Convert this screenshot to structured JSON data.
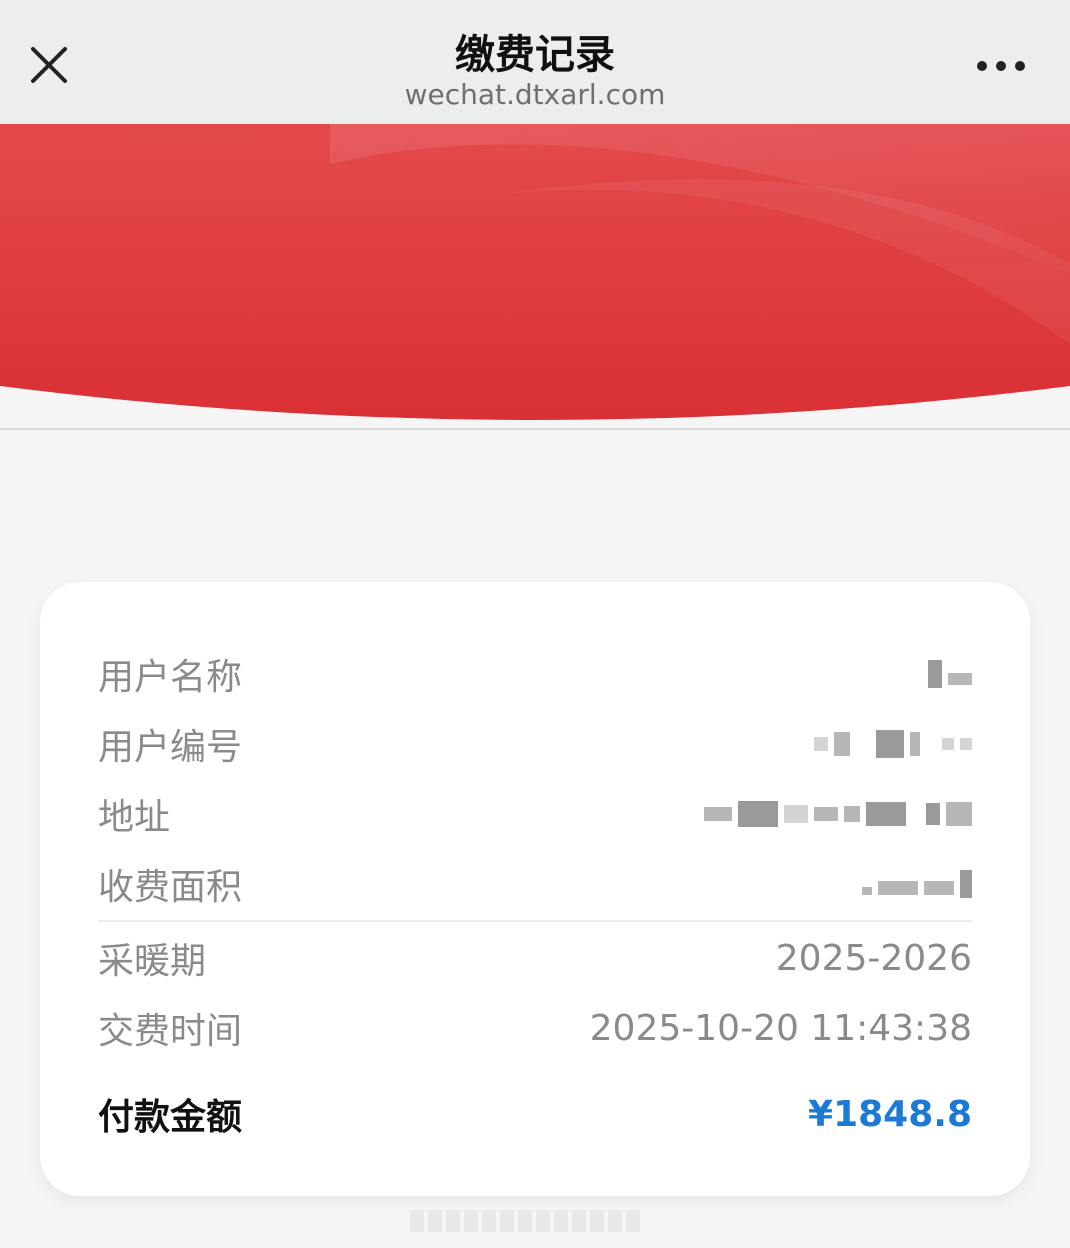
{
  "nav": {
    "title": "缴费记录",
    "url": "wechat.dtxarl.com",
    "close_icon": "close-icon",
    "more_icon": "more-dots-icon"
  },
  "colors": {
    "banner_red": "#e03a3e",
    "amount_blue": "#1a7ad6"
  },
  "record": {
    "user_name_label": "用户名称",
    "user_number_label": "用户编号",
    "address_label": "地址",
    "area_label": "收费面积",
    "heating_period_label": "采暖期",
    "heating_period_value": "2025-2026",
    "pay_time_label": "交费时间",
    "pay_time_value": "2025-10-20 11:43:38",
    "amount_label": "付款金额",
    "amount_value": "¥1848.8"
  }
}
